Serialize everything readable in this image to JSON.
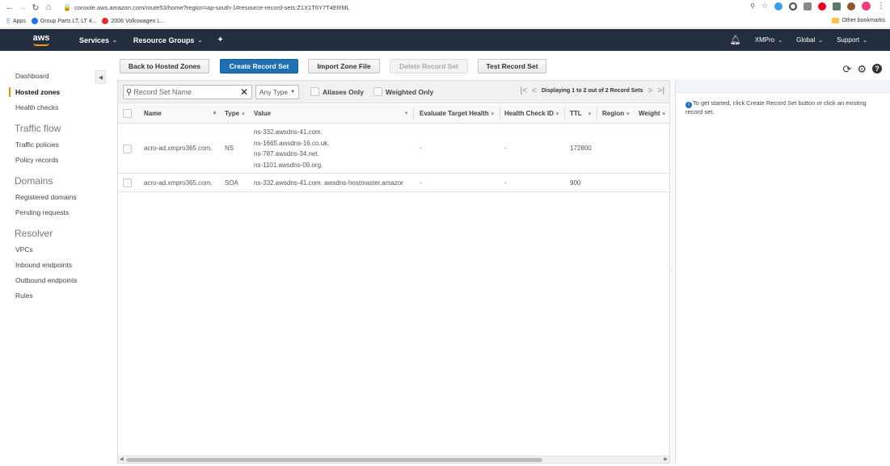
{
  "browser": {
    "url": "console.aws.amazon.com/route53/home?region=ap-south-1#resource-record-sets:Z1X1T6Y7T4ERML",
    "bookmarks": [
      {
        "label": "Apps",
        "color": "#4285f4"
      },
      {
        "label": "Group Parts LT, LT 4...",
        "color": "#1a73e8"
      },
      {
        "label": "2006 Volkswagen L...",
        "color": "#d93025"
      }
    ],
    "other_bookmarks": "Other bookmarks"
  },
  "aws_nav": {
    "logo": "aws",
    "services": "Services",
    "resource_groups": "Resource Groups",
    "account": "XMPro",
    "region": "Global",
    "support": "Support"
  },
  "sidebar": {
    "dashboard": "Dashboard",
    "hosted_zones": "Hosted zones",
    "health_checks": "Health checks",
    "traffic_flow": "Traffic flow",
    "traffic_policies": "Traffic policies",
    "policy_records": "Policy records",
    "domains": "Domains",
    "registered_domains": "Registered domains",
    "pending_requests": "Pending requests",
    "resolver": "Resolver",
    "vpcs": "VPCs",
    "inbound_endpoints": "Inbound endpoints",
    "outbound_endpoints": "Outbound endpoints",
    "rules": "Rules"
  },
  "toolbar": {
    "back": "Back to Hosted Zones",
    "create": "Create Record Set",
    "import": "Import Zone File",
    "delete": "Delete Record Set",
    "test": "Test Record Set"
  },
  "filter": {
    "search_placeholder": "Record Set Name",
    "type_select": "Any Type",
    "aliases_only": "Aliases Only",
    "weighted_only": "Weighted Only",
    "pager_text": "Displaying 1 to 2 out of 2 Record Sets"
  },
  "table": {
    "columns": {
      "name": "Name",
      "type": "Type",
      "value": "Value",
      "evaluate": "Evaluate Target Health",
      "health_check": "Health Check ID",
      "ttl": "TTL",
      "region": "Region",
      "weight": "Weight"
    },
    "rows": [
      {
        "name": "acro-ad.xmpro365.com.",
        "type": "NS",
        "values": [
          "ns-332.awsdns-41.com.",
          "ns-1665.awsdns-16.co.uk.",
          "ns-787.awsdns-34.net.",
          "ns-1101.awsdns-09.org."
        ],
        "evaluate": "-",
        "health_check": "-",
        "ttl": "172800"
      },
      {
        "name": "acro-ad.xmpro365.com.",
        "type": "SOA",
        "values": [
          "ns-332.awsdns-41.com. awsdns-hostmaster.amazor"
        ],
        "evaluate": "-",
        "health_check": "-",
        "ttl": "900"
      }
    ]
  },
  "right_panel": {
    "help": "To get started, click Create Record Set button or click an existing record set."
  }
}
